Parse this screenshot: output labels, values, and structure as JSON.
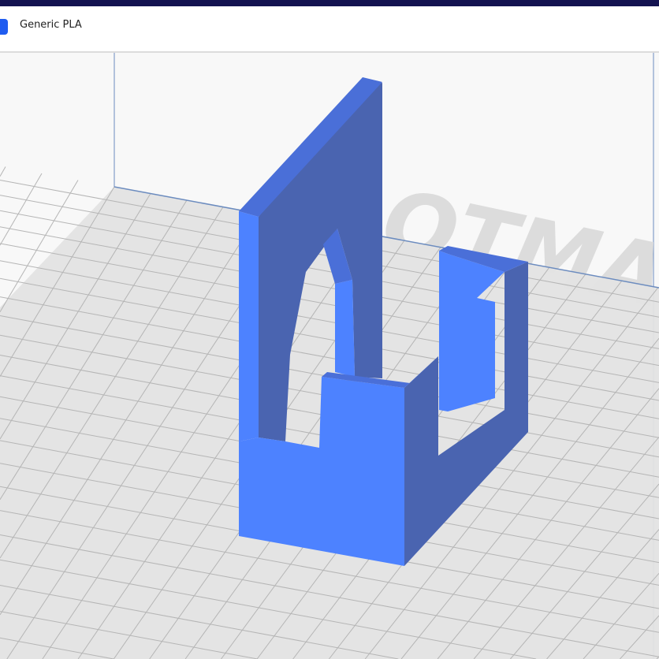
{
  "header": {
    "material_icon": "material-spool-icon",
    "material_label": "Generic PLA"
  },
  "viewport": {
    "watermark": "OTMA"
  },
  "colors": {
    "model_front": "#4d82ff",
    "model_side": "#4a64b0",
    "model_top": "#4a6fd8",
    "build_plate": "#e3e3e3",
    "grid": "#b8b8b8",
    "volume_edge": "#6c8cbf"
  }
}
